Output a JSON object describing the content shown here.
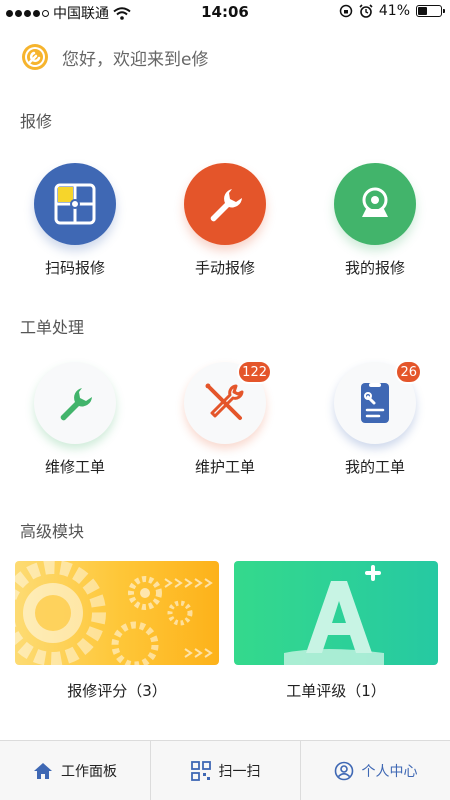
{
  "status_bar": {
    "carrier": "中国联通",
    "time": "14:06",
    "battery": "41%"
  },
  "greeting": {
    "text": "您好，欢迎来到e修",
    "logo_icon": "wrench-logo-icon"
  },
  "sections": {
    "repair": {
      "title": "报修",
      "items": [
        {
          "label": "扫码报修",
          "icon": "qr-scan-icon",
          "color": "#3f68b4"
        },
        {
          "label": "手动报修",
          "icon": "wrench-icon",
          "color": "#e4552a"
        },
        {
          "label": "我的报修",
          "icon": "camera-icon",
          "color": "#42b46b"
        }
      ]
    },
    "workorder": {
      "title": "工单处理",
      "items": [
        {
          "label": "维修工单",
          "icon": "wrench-icon",
          "badge": ""
        },
        {
          "label": "维护工单",
          "icon": "tools-icon",
          "badge": "122"
        },
        {
          "label": "我的工单",
          "icon": "clipboard-icon",
          "badge": "26"
        }
      ]
    },
    "advanced": {
      "title": "高级模块",
      "cards": [
        {
          "label": "报修评分（3）",
          "icon": "gears-icon",
          "color": "#fec739"
        },
        {
          "label": "工单评级（1）",
          "icon": "grade-a-plus-icon",
          "color": "#26c9a2"
        }
      ]
    }
  },
  "bottom_nav": {
    "items": [
      {
        "label": "工作面板",
        "icon": "home-icon"
      },
      {
        "label": "扫一扫",
        "icon": "scan-icon"
      },
      {
        "label": "个人中心",
        "icon": "user-icon"
      }
    ]
  }
}
